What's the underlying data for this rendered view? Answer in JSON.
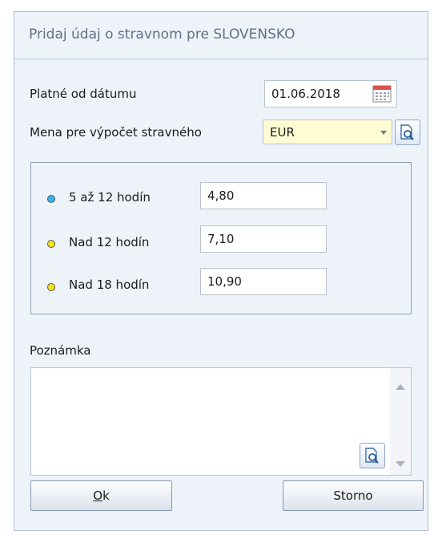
{
  "dialog": {
    "title": "Pridaj údaj o stravnom pre SLOVENSKO",
    "valid_from_label": "Platné od dátumu",
    "valid_from_value": "01.06.2018",
    "currency_label": "Mena pre výpočet stravného",
    "currency_value": "EUR",
    "rates": [
      {
        "label": "5 až 12 hodín",
        "value": "4,80",
        "dot_color": "#2fb6f0"
      },
      {
        "label": "Nad 12 hodín",
        "value": "7,10",
        "dot_color": "#f2e316"
      },
      {
        "label": "Nad 18 hodín",
        "value": "10,90",
        "dot_color": "#f2e316"
      }
    ],
    "note_label": "Poznámka",
    "note_value": "",
    "ok_label_accel": "O",
    "ok_label_rest": "k",
    "cancel_label": "Storno"
  },
  "icons": {
    "calendar": "calendar-icon",
    "lookup": "magnifier-document-icon",
    "dropdown": "chevron-down-icon",
    "scroll_up": "scroll-up-arrow",
    "scroll_down": "scroll-down-arrow"
  },
  "colors": {
    "title_text": "#5f6f85",
    "dialog_bg": "#eef3fa",
    "combo_bg": "#fffcd4",
    "calendar_accent": "#d9534f"
  }
}
